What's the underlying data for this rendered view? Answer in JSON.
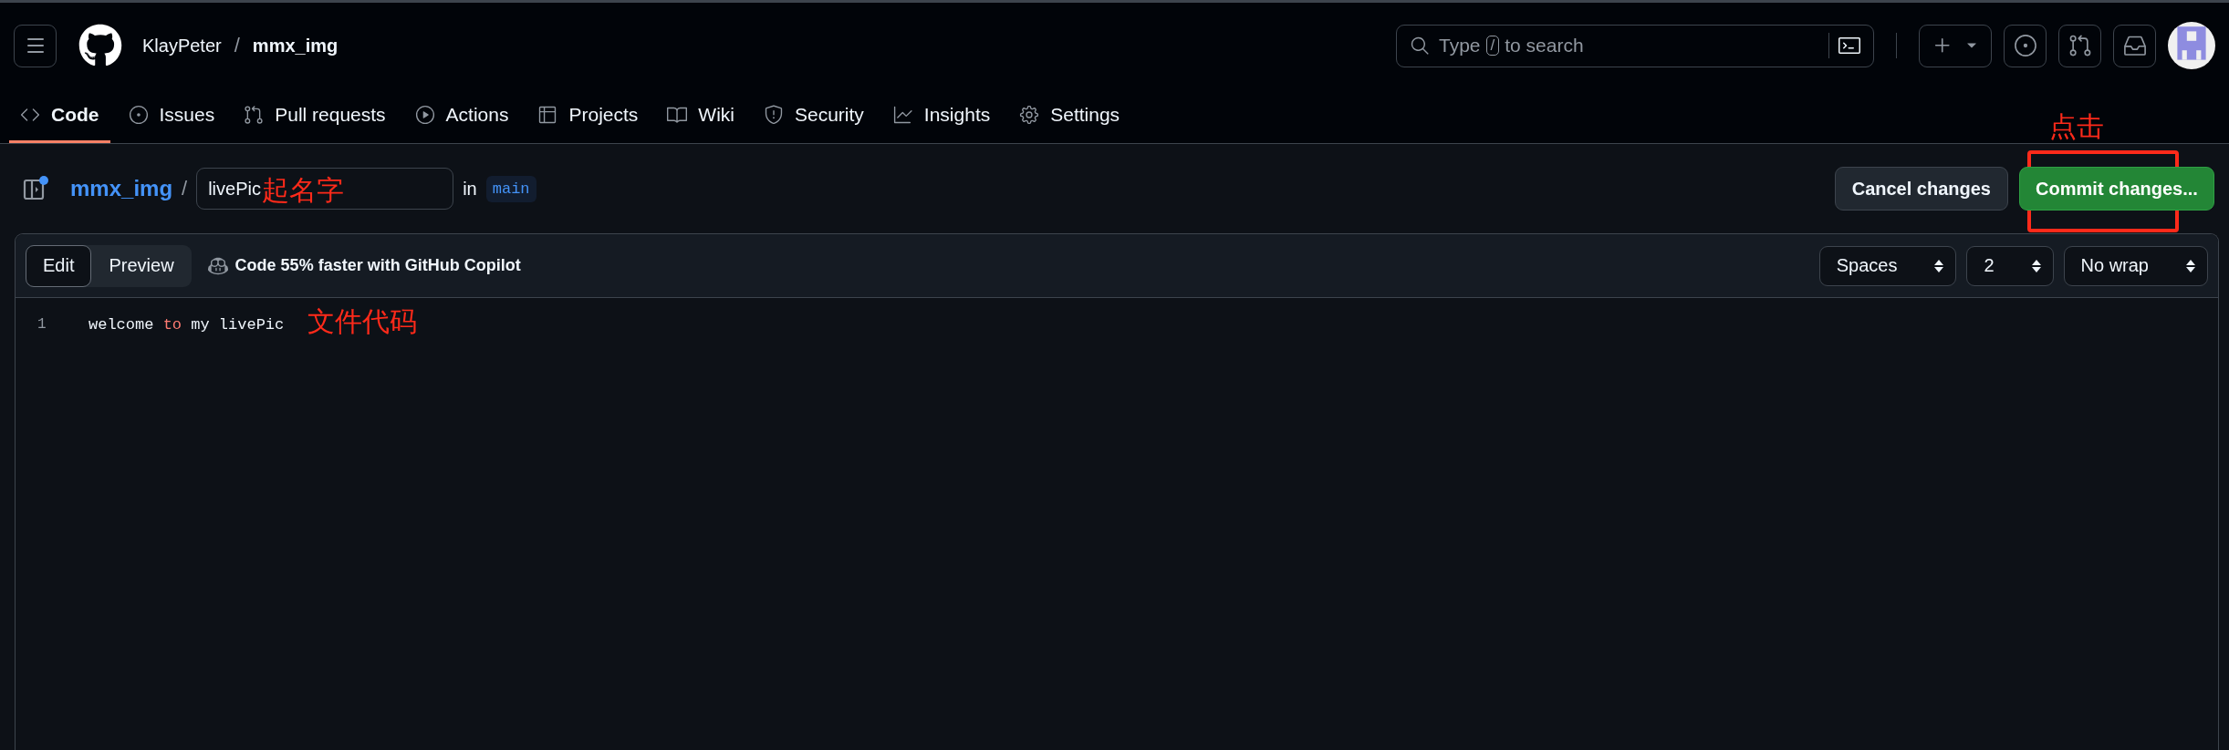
{
  "header": {
    "owner": "KlayPeter",
    "separator": "/",
    "repo": "mmx_img",
    "search": {
      "placeholder_before": "Type",
      "key": "/",
      "placeholder_after": "to search"
    }
  },
  "nav_tabs": [
    {
      "label": "Code",
      "selected": true
    },
    {
      "label": "Issues",
      "selected": false
    },
    {
      "label": "Pull requests",
      "selected": false
    },
    {
      "label": "Actions",
      "selected": false
    },
    {
      "label": "Projects",
      "selected": false
    },
    {
      "label": "Wiki",
      "selected": false
    },
    {
      "label": "Security",
      "selected": false
    },
    {
      "label": "Insights",
      "selected": false
    },
    {
      "label": "Settings",
      "selected": false
    }
  ],
  "file_bar": {
    "repo_link": "mmx_img",
    "separator": "/",
    "filename": "livePic",
    "filename_annotation": "起名字",
    "in_label": "in",
    "branch": "main",
    "cancel_button": "Cancel changes",
    "commit_button": "Commit changes...",
    "commit_annotation": "点击",
    "commit_highlighted": true
  },
  "editor": {
    "mode_tabs": [
      {
        "label": "Edit",
        "selected": true
      },
      {
        "label": "Preview",
        "selected": false
      }
    ],
    "copilot_hint": "Code 55% faster with GitHub Copilot",
    "selects": [
      {
        "value": "Spaces"
      },
      {
        "value": "2"
      },
      {
        "value": "No wrap"
      }
    ],
    "lines": [
      {
        "number": "1",
        "tokens": [
          {
            "kind": "plain",
            "text": "welcome "
          },
          {
            "kind": "keyword",
            "text": "to"
          },
          {
            "kind": "plain",
            "text": " my livePic"
          }
        ]
      }
    ],
    "annotation": "文件代码"
  }
}
